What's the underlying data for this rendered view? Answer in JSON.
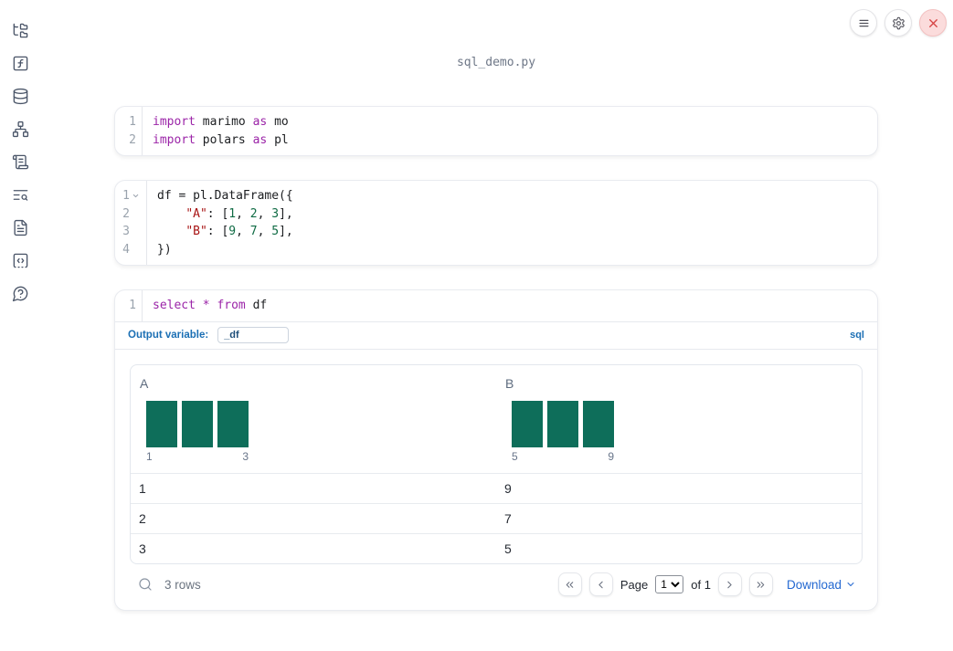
{
  "app": {
    "filename": "sql_demo.py"
  },
  "topbar": {
    "buttons": [
      {
        "id": "notebook-menu",
        "icon": "hamburger-menu-icon"
      },
      {
        "id": "settings",
        "icon": "gear-icon"
      },
      {
        "id": "shutdown",
        "icon": "close-x-icon"
      }
    ]
  },
  "sidebar": {
    "items": [
      {
        "id": "file-explorer",
        "icon": "file-tree-icon"
      },
      {
        "id": "variables",
        "icon": "function-square-icon"
      },
      {
        "id": "datasources",
        "icon": "database-icon"
      },
      {
        "id": "dependencies",
        "icon": "network-icon"
      },
      {
        "id": "logs",
        "icon": "scroll-icon"
      },
      {
        "id": "tracing",
        "icon": "list-search-icon"
      },
      {
        "id": "documentation",
        "icon": "file-text-icon"
      },
      {
        "id": "snippets",
        "icon": "code-square-icon"
      },
      {
        "id": "help",
        "icon": "help-bubble-icon"
      }
    ]
  },
  "cells": [
    {
      "language": "python",
      "fold_gutter": false,
      "lines": [
        {
          "n": "1",
          "tokens": [
            {
              "s": "kw",
              "v": "import"
            },
            {
              "s": "pl",
              "v": " marimo "
            },
            {
              "s": "kw",
              "v": "as"
            },
            {
              "s": "pl",
              "v": " mo"
            }
          ]
        },
        {
          "n": "2",
          "tokens": [
            {
              "s": "kw",
              "v": "import"
            },
            {
              "s": "pl",
              "v": " polars "
            },
            {
              "s": "kw",
              "v": "as"
            },
            {
              "s": "pl",
              "v": " pl"
            }
          ]
        }
      ]
    },
    {
      "language": "python",
      "fold_gutter": true,
      "lines": [
        {
          "n": "1",
          "fold": true,
          "tokens": [
            {
              "s": "pl",
              "v": "df = pl.DataFrame({"
            }
          ]
        },
        {
          "n": "2",
          "tokens": [
            {
              "s": "pl",
              "v": "    "
            },
            {
              "s": "str",
              "v": "\"A\""
            },
            {
              "s": "pl",
              "v": ": ["
            },
            {
              "s": "num",
              "v": "1"
            },
            {
              "s": "pl",
              "v": ", "
            },
            {
              "s": "num",
              "v": "2"
            },
            {
              "s": "pl",
              "v": ", "
            },
            {
              "s": "num",
              "v": "3"
            },
            {
              "s": "pl",
              "v": "],"
            }
          ]
        },
        {
          "n": "3",
          "tokens": [
            {
              "s": "pl",
              "v": "    "
            },
            {
              "s": "str",
              "v": "\"B\""
            },
            {
              "s": "pl",
              "v": ": ["
            },
            {
              "s": "num",
              "v": "9"
            },
            {
              "s": "pl",
              "v": ", "
            },
            {
              "s": "num",
              "v": "7"
            },
            {
              "s": "pl",
              "v": ", "
            },
            {
              "s": "num",
              "v": "5"
            },
            {
              "s": "pl",
              "v": "],"
            }
          ]
        },
        {
          "n": "4",
          "tokens": [
            {
              "s": "pl",
              "v": "})"
            }
          ]
        }
      ]
    },
    {
      "language": "sql",
      "fold_gutter": false,
      "lines": [
        {
          "n": "1",
          "tokens": [
            {
              "s": "kw",
              "v": "select"
            },
            {
              "s": "pl",
              "v": " "
            },
            {
              "s": "kw",
              "v": "*"
            },
            {
              "s": "pl",
              "v": " "
            },
            {
              "s": "kw",
              "v": "from"
            },
            {
              "s": "pl",
              "v": " df"
            }
          ]
        }
      ]
    }
  ],
  "sql_cell": {
    "output_variable_label": "Output variable:",
    "output_variable_value": "_df",
    "language_badge": "sql"
  },
  "table": {
    "columns": [
      {
        "header": "A",
        "histogram": {
          "type": "bar",
          "bar_heights": [
            1,
            1,
            1
          ],
          "min_label": "1",
          "max_label": "3"
        }
      },
      {
        "header": "B",
        "histogram": {
          "type": "bar",
          "bar_heights": [
            1,
            1,
            1
          ],
          "min_label": "5",
          "max_label": "9"
        }
      }
    ],
    "rows": [
      [
        "1",
        "9"
      ],
      [
        "2",
        "7"
      ],
      [
        "3",
        "5"
      ]
    ],
    "footer": {
      "row_count": "3 rows",
      "page_label": "Page",
      "page_value": "1",
      "page_total_label": "of 1",
      "download_label": "Download"
    }
  },
  "colors": {
    "keyword": "#9b24a8",
    "string": "#a81414",
    "number": "#0f6b44",
    "histogram_bar": "#0e6e5a",
    "sql_accent_blue": "#1b6fb4",
    "link_blue": "#2368d1",
    "close_red": "#d64545"
  }
}
